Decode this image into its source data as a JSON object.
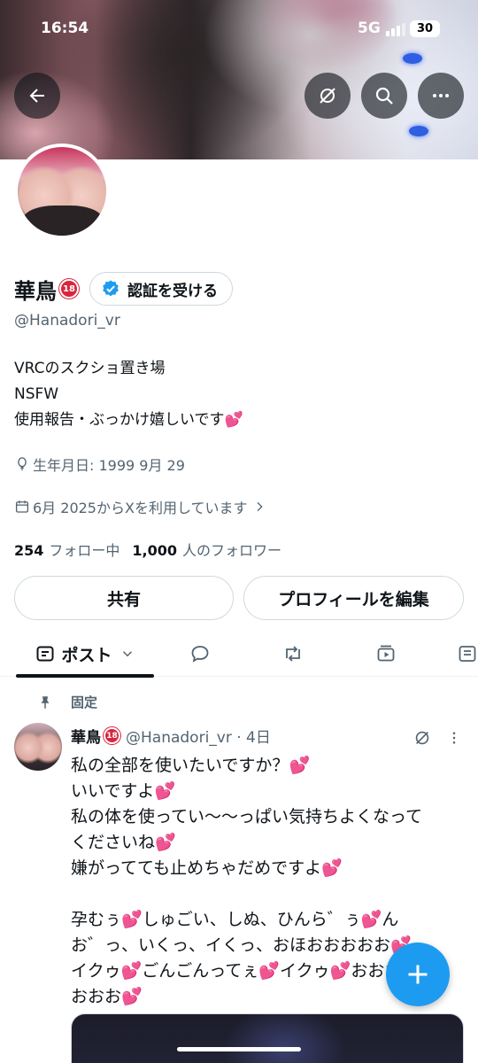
{
  "status_bar": {
    "time": "16:54",
    "network": "5G",
    "battery": "30"
  },
  "header": {
    "back_icon": "arrow-left-icon",
    "mute_icon": "eye-slash-icon",
    "search_icon": "search-icon",
    "more_icon": "more-horizontal-icon"
  },
  "profile": {
    "display_name": "華鳥",
    "badge_18": "18",
    "verify_label": "認証を受ける",
    "handle": "@Hanadori_vr",
    "bio_lines": [
      "VRCのスクショ置き場",
      "NSFW",
      "使用報告・ぶっかけ嬉しいです"
    ],
    "bio_emoji": "💕",
    "birthday": "生年月日: 1999 9月 29",
    "joined": "6月 2025からXを利用しています",
    "following_count": "254",
    "following_label": "フォロー中",
    "followers_count": "1,000",
    "followers_label": "人のフォロワー"
  },
  "actions": {
    "share_label": "共有",
    "edit_label": "プロフィールを編集"
  },
  "tabs": {
    "posts_label": "ポスト"
  },
  "pinned_post": {
    "pinned_label": "固定",
    "author_name": "華鳥",
    "author_meta": "@Hanadori_vr · 4日",
    "lines": [
      "私の全部を使いたいですか？",
      "いいですよ",
      "私の体を使ってい〜〜っぱい気持ちよくなって",
      "くださいね",
      "嫌がってても止めちゃだめですよ",
      "",
      "孕むぅ",
      "しゅごい、しぬ、ひんら゛ぅ",
      "ん",
      "お゛っ、いくっ、イくっ、おほおおおおお",
      "イクゥ",
      "ごんごんってぇ",
      "イクゥ",
      "おおお",
      "おおお"
    ],
    "heart": "💕"
  },
  "colors": {
    "accent": "#1d9bf0",
    "heart": "#e8458b",
    "secondary_text": "#536471"
  }
}
